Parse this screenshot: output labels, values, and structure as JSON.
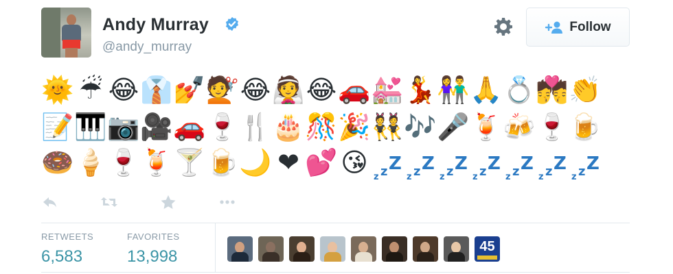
{
  "user": {
    "name": "Andy Murray",
    "handle": "@andy_murray",
    "verified": true
  },
  "follow_button": {
    "label": "Follow"
  },
  "tweet_emoji": {
    "row1": [
      "🌞",
      "☔",
      "😂",
      "👔",
      "💅",
      "💇",
      "😂",
      "👰",
      "😂",
      "🚗",
      "💒",
      "💃",
      "👫",
      "🙏",
      "💍",
      "💏",
      "👏"
    ],
    "row2": [
      "📝",
      "🎹",
      "📷",
      "🎥",
      "🚗",
      "🍷",
      "🍴",
      "🎂",
      "🎊",
      "🎉",
      "👯",
      "🎶",
      "🎤",
      "🍹",
      "🍻",
      "🍷",
      "🍺"
    ],
    "row3": [
      "🍩",
      "🍦",
      "🍷",
      "🍹",
      "🍸",
      "🍺",
      "🌙",
      "❤",
      "💕",
      "😘"
    ],
    "row3_sleep_count": 7
  },
  "actions": {
    "reply_icon": "reply-icon",
    "retweet_icon": "retweet-icon",
    "favorite_icon": "star-icon",
    "more_icon": "more-icon"
  },
  "stats": {
    "retweets_label": "RETWEETS",
    "retweets_value": "6,583",
    "favorites_label": "FAVORITES",
    "favorites_value": "13,998"
  },
  "favorited_by": {
    "count_shown": 9,
    "last_avatar_text": "45"
  },
  "colors": {
    "verified_blue": "#55acee",
    "stat_value": "#3b94a6",
    "muted_text": "#8899a6",
    "sleep_z": "#2b79c2"
  }
}
